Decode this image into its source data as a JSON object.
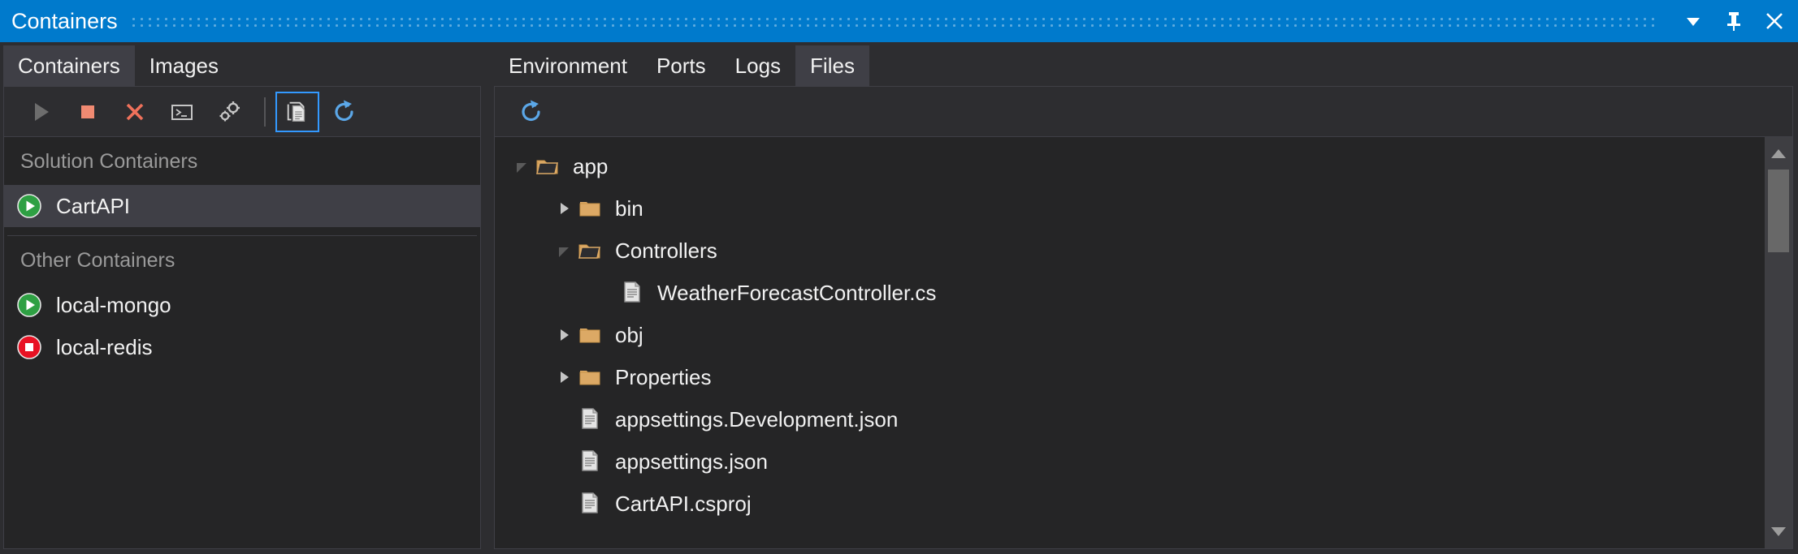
{
  "window": {
    "title": "Containers",
    "accent_color": "#007acc",
    "buttons": [
      {
        "name": "window-dropdown-button",
        "icon": "chevron-down-icon"
      },
      {
        "name": "window-pin-button",
        "icon": "pin-icon"
      },
      {
        "name": "window-close-button",
        "icon": "close-icon"
      }
    ]
  },
  "left_panel": {
    "tabs": [
      {
        "label": "Containers",
        "active": true
      },
      {
        "label": "Images",
        "active": false
      }
    ],
    "toolbar": [
      {
        "name": "start-button",
        "icon": "play-icon",
        "state": "disabled",
        "color": "#6d6d6d"
      },
      {
        "name": "stop-button",
        "icon": "stop-icon",
        "state": "enabled",
        "color": "#f08a72"
      },
      {
        "name": "remove-button",
        "icon": "close-x-icon",
        "state": "enabled",
        "color": "#f0715b"
      },
      {
        "name": "open-terminal-button",
        "icon": "terminal-icon",
        "state": "enabled",
        "color": "#c5c5c5"
      },
      {
        "name": "settings-button",
        "icon": "gears-icon",
        "state": "enabled",
        "color": "#c5c5c5"
      },
      {
        "name": "view-files-button",
        "icon": "files-icon",
        "state": "selected",
        "color": "#d4d4d4"
      },
      {
        "name": "refresh-button",
        "icon": "refresh-icon",
        "state": "enabled",
        "color": "#5ba7e8"
      }
    ],
    "groups": [
      {
        "header": "Solution Containers",
        "items": [
          {
            "label": "CartAPI",
            "status": "running",
            "status_icon": "running-play-icon",
            "selected": true
          }
        ]
      },
      {
        "header": "Other Containers",
        "items": [
          {
            "label": "local-mongo",
            "status": "running",
            "status_icon": "running-play-icon",
            "selected": false
          },
          {
            "label": "local-redis",
            "status": "stopped",
            "status_icon": "stopped-square-icon",
            "selected": false
          }
        ]
      }
    ],
    "status_colors": {
      "running": "#2ea043",
      "stopped": "#e81123"
    }
  },
  "right_panel": {
    "tabs": [
      {
        "label": "Environment",
        "active": false
      },
      {
        "label": "Ports",
        "active": false
      },
      {
        "label": "Logs",
        "active": false
      },
      {
        "label": "Files",
        "active": true
      }
    ],
    "toolbar": [
      {
        "name": "refresh-files-button",
        "icon": "refresh-icon",
        "color": "#5ba7e8"
      }
    ],
    "file_tree": [
      {
        "label": "app",
        "type": "folder",
        "depth": 0,
        "expanded": true
      },
      {
        "label": "bin",
        "type": "folder",
        "depth": 1,
        "expanded": false
      },
      {
        "label": "Controllers",
        "type": "folder",
        "depth": 1,
        "expanded": true
      },
      {
        "label": "WeatherForecastController.cs",
        "type": "file",
        "depth": 2
      },
      {
        "label": "obj",
        "type": "folder",
        "depth": 1,
        "expanded": false
      },
      {
        "label": "Properties",
        "type": "folder",
        "depth": 1,
        "expanded": false
      },
      {
        "label": "appsettings.Development.json",
        "type": "file",
        "depth": 1
      },
      {
        "label": "appsettings.json",
        "type": "file",
        "depth": 1
      },
      {
        "label": "CartAPI.csproj",
        "type": "file",
        "depth": 1
      }
    ],
    "folder_color": "#dca965",
    "file_color": "#c5c5c5",
    "scrollbar": {
      "name": "files-vertical-scrollbar",
      "thumb_position": "near-top"
    }
  }
}
